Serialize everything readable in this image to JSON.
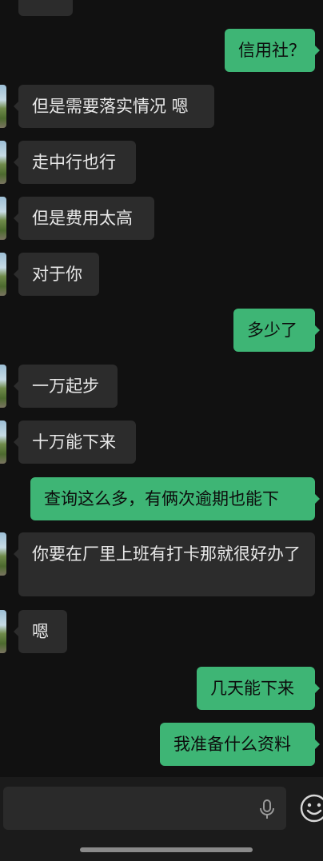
{
  "messages": [
    {
      "side": "in",
      "text": ""
    },
    {
      "side": "out",
      "text": "信用社？"
    },
    {
      "side": "in",
      "text": "但是需要落实情况 嗯"
    },
    {
      "side": "in",
      "text": "走中行也行"
    },
    {
      "side": "in",
      "text": "但是费用太高"
    },
    {
      "side": "in",
      "text": "对于你"
    },
    {
      "side": "out",
      "text": "多少了"
    },
    {
      "side": "in",
      "text": "一万起步"
    },
    {
      "side": "in",
      "text": "十万能下来"
    },
    {
      "side": "out",
      "text": "查询这么多，有俩次逾期也能下"
    },
    {
      "side": "in",
      "text": "你要在厂里上班有打卡那就很好办了"
    },
    {
      "side": "in",
      "text": "嗯"
    },
    {
      "side": "out",
      "text": "几天能下来"
    },
    {
      "side": "out",
      "text": "我准备什么资料"
    }
  ],
  "input": {
    "value": "",
    "placeholder": ""
  },
  "icons": {
    "voice": "microphone-icon",
    "emoji": "emoji-icon"
  },
  "colors": {
    "background": "#111111",
    "incoming_bubble": "#2c2c2c",
    "outgoing_bubble": "#3eb575",
    "input_bar": "#1b1b1b"
  }
}
